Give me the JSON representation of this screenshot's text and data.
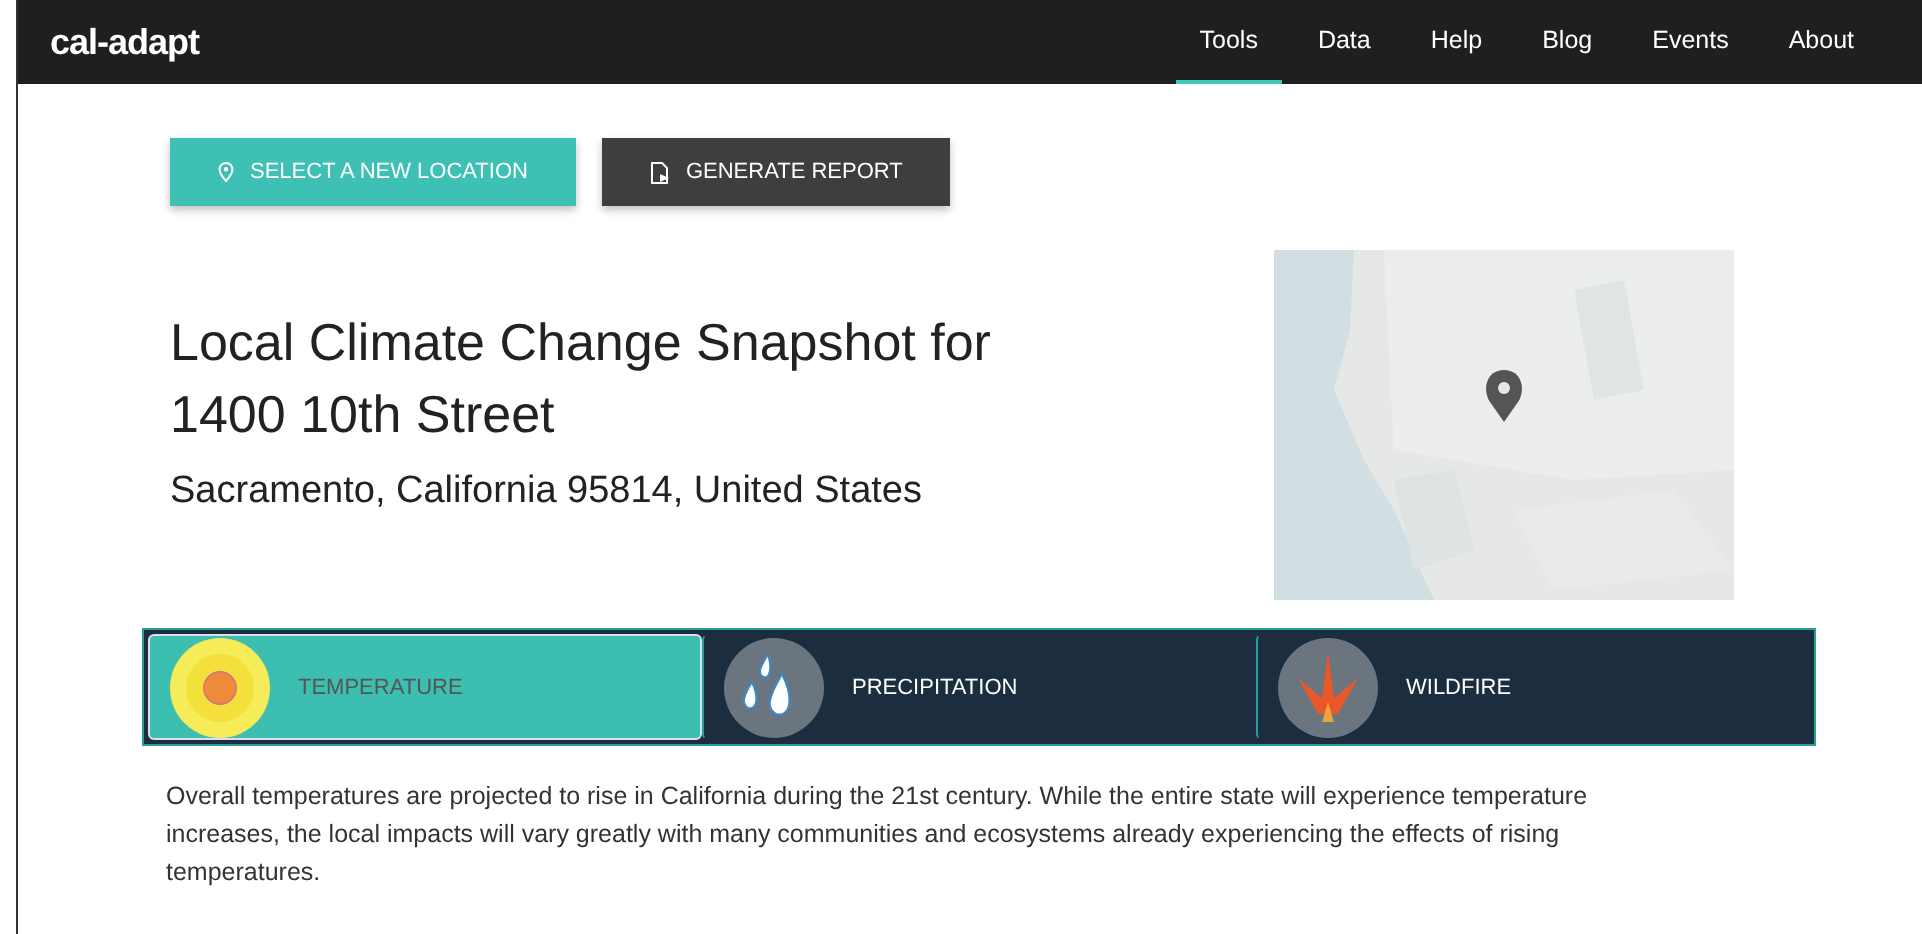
{
  "header": {
    "logo": "cal-adapt",
    "nav": [
      {
        "label": "Tools",
        "selected": true
      },
      {
        "label": "Data",
        "selected": false
      },
      {
        "label": "Help",
        "selected": false
      },
      {
        "label": "Blog",
        "selected": false
      },
      {
        "label": "Events",
        "selected": false
      },
      {
        "label": "About",
        "selected": false
      }
    ]
  },
  "actions": [
    {
      "label": "SELECT A NEW LOCATION",
      "kind": "primary"
    },
    {
      "label": "GENERATE REPORT",
      "kind": "secondary"
    }
  ],
  "title": "Local Climate Change Snapshot for 1400 10th Street",
  "subtitle": "Sacramento, California 95814, United States",
  "topics": [
    {
      "label": "TEMPERATURE",
      "kind": "sun",
      "selected": true
    },
    {
      "label": "PRECIPITATION",
      "kind": "drops",
      "selected": false
    },
    {
      "label": "WILDFIRE",
      "kind": "fire",
      "selected": false
    }
  ],
  "description": "Overall temperatures are projected to rise in California during the 21st century. While the entire state will experience temperature increases, the local impacts will vary greatly with many communities and ecosystems already experiencing the effects of rising temperatures."
}
